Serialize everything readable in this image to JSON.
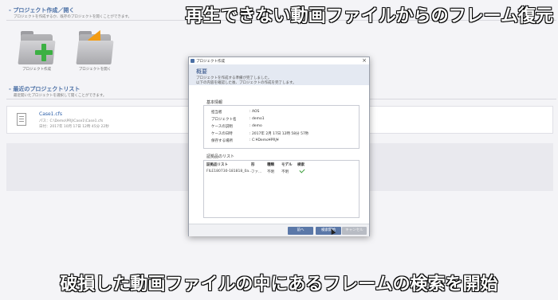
{
  "captions": {
    "top": "再生できない動画ファイルからのフレーム復元",
    "bottom": "破損した動画ファイルの中にあるフレームの検索を開始"
  },
  "app": {
    "section_create": {
      "title": "- プロジェクト作成／開く",
      "subtitle": "プロジェクトを作成するか、既存のプロジェクトを開くことができます。",
      "new_label": "プロジェクト作成",
      "open_label": "プロジェクトを開く",
      "new_icon": "folder-plus-icon",
      "open_icon": "folder-open-icon"
    },
    "section_recent": {
      "title": "- 最近のプロジェクトリスト",
      "subtitle": "最近開いたプロジェクトを選択して開くことができます。",
      "cases": [
        {
          "name": "Case1.cfs",
          "path": "パス：C:\\Demo\\PRJ\\Case1\\Case1.cfs",
          "date": "日付：2017年 10月 17日 12時 45分 22秒"
        }
      ]
    }
  },
  "dialog": {
    "title": "プロジェクト作成",
    "header_title": "概要",
    "header_line1": "プロジェクトを作成する準備が完了しました。",
    "header_line2": "以下の内容を確認した後、プロジェクトの作成を完了します。",
    "basic_info": {
      "label": "基本情報",
      "rows": [
        {
          "key": "担当者",
          "value": ": AOS"
        },
        {
          "key": "プロジェクト名",
          "value": ": demo1"
        },
        {
          "key": "ケースの説明",
          "value": ": demo"
        },
        {
          "key": "ケースの日時",
          "value": ": 2017年 2月 17日 12時 58分 57秒"
        },
        {
          "key": "保存する場所",
          "value": ": C:¥Demo¥PRJ¥"
        }
      ]
    },
    "evidence": {
      "label": "証拠品のリスト",
      "headers": [
        "証拠品リスト",
        "形",
        "種類",
        "モデル",
        "検索"
      ],
      "rows": [
        {
          "name": "FILE180730-181818_0a...",
          "form": "ファ...",
          "kind": "不明",
          "model": "不明",
          "search": "checked"
        }
      ]
    },
    "buttons": {
      "back": "前へ",
      "start": "検索開始",
      "cancel": "キャンセル"
    }
  }
}
